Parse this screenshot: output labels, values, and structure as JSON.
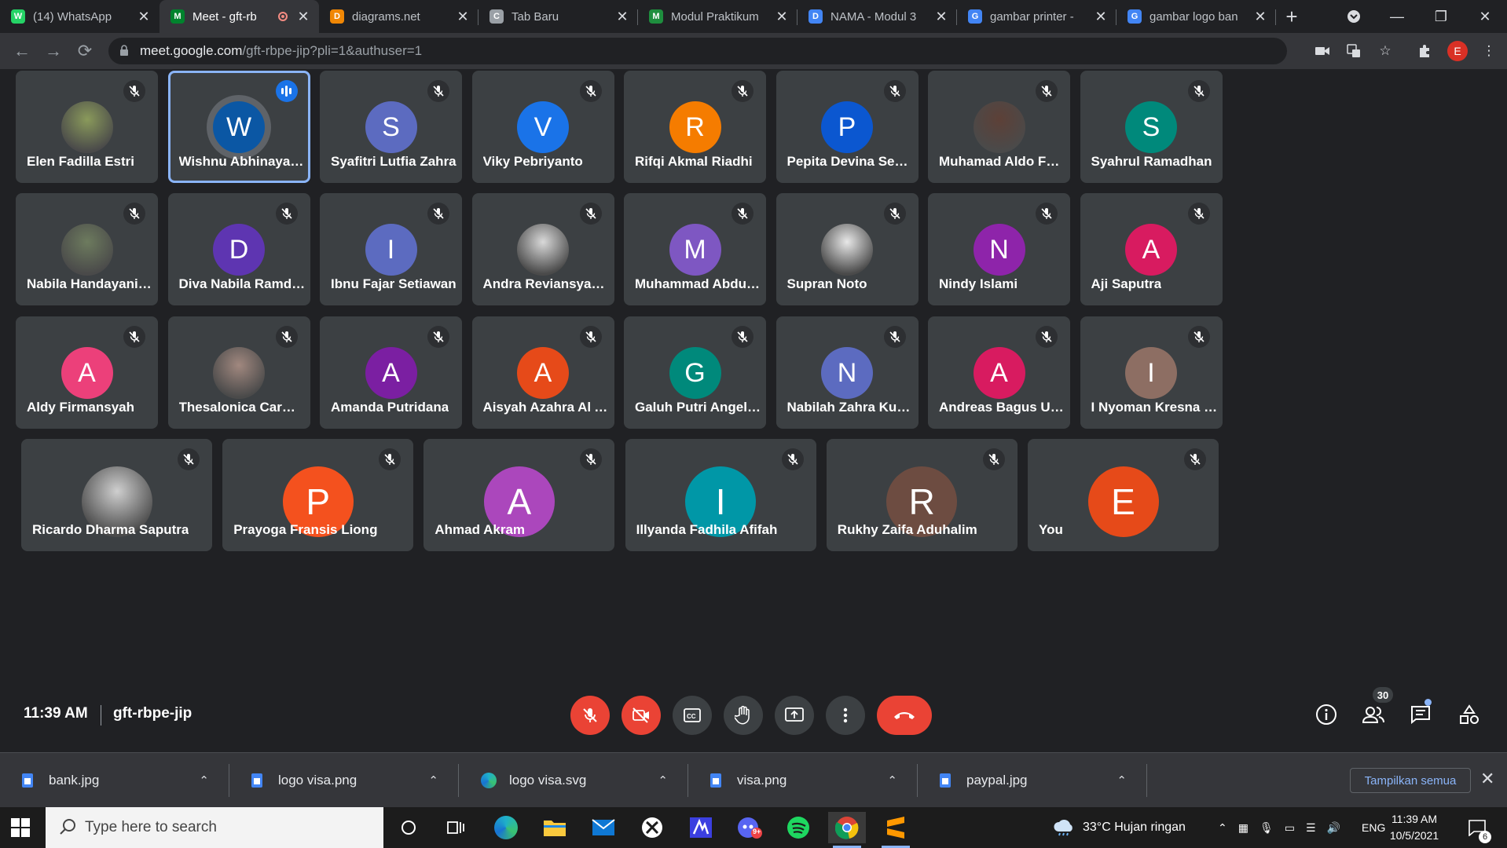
{
  "browser": {
    "tabs": [
      {
        "label": "(14) WhatsApp",
        "favicon": "whatsapp-icon",
        "color": "#25d366",
        "glyph": "W",
        "active": false
      },
      {
        "label": "Meet - gft-rb",
        "favicon": "meet-icon",
        "color": "#00832d",
        "glyph": "M",
        "active": true,
        "recording": true
      },
      {
        "label": "diagrams.net",
        "favicon": "drawio-icon",
        "color": "#f08705",
        "glyph": "D",
        "active": false
      },
      {
        "label": "Tab Baru",
        "favicon": "chrome-icon",
        "color": "#9aa0a6",
        "glyph": "C",
        "active": false
      },
      {
        "label": "Modul Praktikum",
        "favicon": "classroom-icon",
        "color": "#1e8e3e",
        "glyph": "M",
        "active": false
      },
      {
        "label": "NAMA - Modul 3",
        "favicon": "docs-icon",
        "color": "#4285f4",
        "glyph": "D",
        "active": false
      },
      {
        "label": "gambar printer -",
        "favicon": "google-icon",
        "color": "#4285f4",
        "glyph": "G",
        "active": false
      },
      {
        "label": "gambar logo ban",
        "favicon": "google-icon",
        "color": "#4285f4",
        "glyph": "G",
        "active": false
      }
    ],
    "url_host": "meet.google.com",
    "url_path": "/gft-rbpe-jip?pli=1&authuser=1",
    "profile_initial": "E"
  },
  "meet": {
    "participants_row1": [
      {
        "name": "Elen Fadilla Estri",
        "initial": "",
        "color": "#8a9a5b",
        "photo": true
      },
      {
        "name": "Wishnu Abhinaya Sul...",
        "initial": "W",
        "color": "#0b57a4",
        "speaking": true
      },
      {
        "name": "Syafitri Lutfia Zahra",
        "initial": "S",
        "color": "#5c6bc0"
      },
      {
        "name": "Viky Pebriyanto",
        "initial": "V",
        "color": "#1a73e8"
      },
      {
        "name": "Rifqi Akmal Riadhi",
        "initial": "R",
        "color": "#f57c00"
      },
      {
        "name": "Pepita Devina Septhin",
        "initial": "P",
        "color": "#0b57d0"
      },
      {
        "name": "Muhamad Aldo Ferna...",
        "initial": "",
        "color": "#5d4037",
        "photo": true
      },
      {
        "name": "Syahrul Ramadhan",
        "initial": "S",
        "color": "#00897b"
      }
    ],
    "participants_row2": [
      {
        "name": "Nabila Handayani Bete",
        "initial": "",
        "color": "#6d7b5e",
        "photo": true
      },
      {
        "name": "Diva Nabila Ramdani",
        "initial": "D",
        "color": "#5e35b1"
      },
      {
        "name": "Ibnu Fajar Setiawan",
        "initial": "I",
        "color": "#5c6bc0"
      },
      {
        "name": "Andra Reviansyah Ma...",
        "initial": "",
        "color": "#d9d9d9",
        "photo": true
      },
      {
        "name": "Muhammad Abdullah...",
        "initial": "M",
        "color": "#7e57c2"
      },
      {
        "name": "Supran Noto",
        "initial": "",
        "color": "#e8e8e8",
        "photo": true
      },
      {
        "name": "Nindy Islami",
        "initial": "N",
        "color": "#8e24aa"
      },
      {
        "name": "Aji Saputra",
        "initial": "A",
        "color": "#d81b60"
      }
    ],
    "participants_row3": [
      {
        "name": "Aldy Firmansyah",
        "initial": "A",
        "color": "#ec407a"
      },
      {
        "name": "Thesalonica Carmeni...",
        "initial": "",
        "color": "#a1887f",
        "photo": true
      },
      {
        "name": "Amanda Putridana",
        "initial": "A",
        "color": "#7b1fa2"
      },
      {
        "name": "Aisyah Azahra Al Am...",
        "initial": "A",
        "color": "#e64a19"
      },
      {
        "name": "Galuh Putri Angelina",
        "initial": "G",
        "color": "#00897b"
      },
      {
        "name": "Nabilah Zahra Kusuma",
        "initial": "N",
        "color": "#5c6bc0"
      },
      {
        "name": "Andreas Bagus Upo A...",
        "initial": "A",
        "color": "#d81b60"
      },
      {
        "name": "I Nyoman Kresna Har...",
        "initial": "I",
        "color": "#8d6e63"
      }
    ],
    "participants_row4": [
      {
        "name": "Ricardo Dharma Saputra",
        "initial": "",
        "color": "#cfcfcf",
        "photo": true
      },
      {
        "name": "Prayoga Fransis Liong",
        "initial": "P",
        "color": "#f4511e"
      },
      {
        "name": "Ahmad Akram",
        "initial": "A",
        "color": "#ab47bc"
      },
      {
        "name": "Illyanda Fadhila Afifah",
        "initial": "I",
        "color": "#0097a7"
      },
      {
        "name": "Rukhy Zaifa Aduhalim",
        "initial": "R",
        "color": "#6d4c41"
      },
      {
        "name": "You",
        "initial": "E",
        "color": "#e64a19"
      }
    ],
    "time": "11:39 AM",
    "meeting_code": "gft-rbpe-jip",
    "participant_count": "30"
  },
  "downloads": {
    "items": [
      {
        "label": "bank.jpg",
        "icon": "file-icon"
      },
      {
        "label": "logo visa.png",
        "icon": "file-icon"
      },
      {
        "label": "logo visa.svg",
        "icon": "edge-icon"
      },
      {
        "label": "visa.png",
        "icon": "file-icon"
      },
      {
        "label": "paypal.jpg",
        "icon": "file-icon"
      }
    ],
    "show_all_label": "Tampilkan semua"
  },
  "taskbar": {
    "search_placeholder": "Type here to search",
    "weather": "33°C  Hujan ringan",
    "language": "ENG",
    "time": "11:39 AM",
    "date": "10/5/2021",
    "notification_count": "6",
    "discord_badge": "9+"
  }
}
